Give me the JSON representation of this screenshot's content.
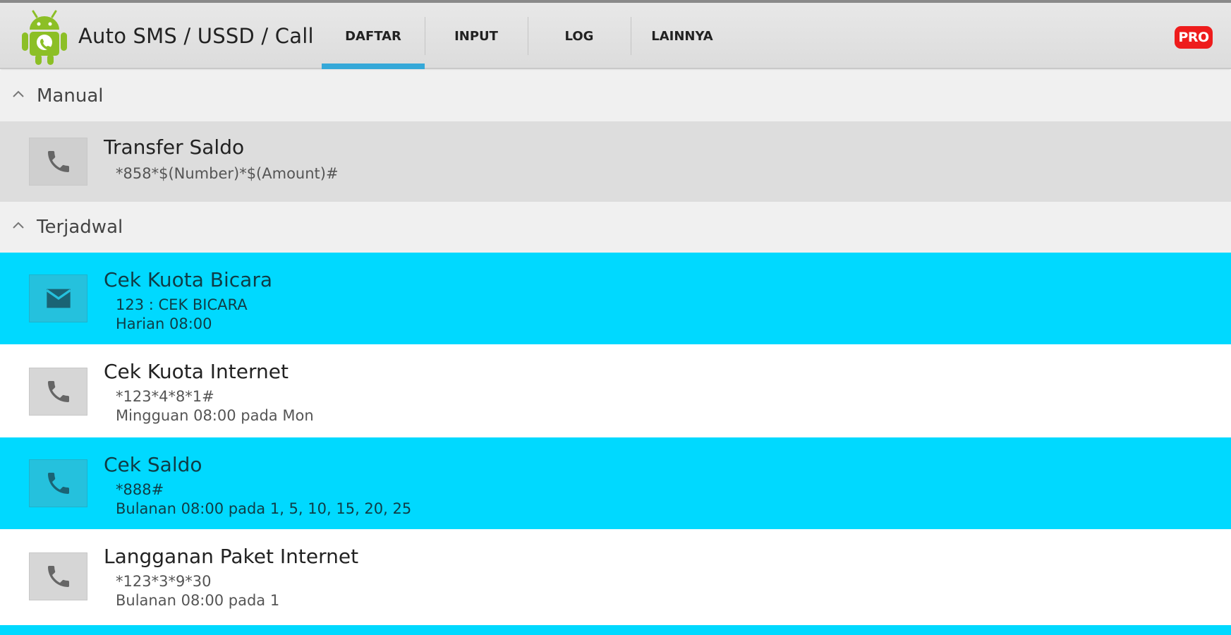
{
  "app": {
    "title": "Auto SMS / USSD / Call",
    "pro_label": "PRO"
  },
  "tabs": [
    {
      "label": "DAFTAR",
      "active": true
    },
    {
      "label": "INPUT",
      "active": false
    },
    {
      "label": "LOG",
      "active": false
    },
    {
      "label": "LAINNYA",
      "active": false
    }
  ],
  "sections": {
    "manual": {
      "label": "Manual",
      "items": [
        {
          "title": "Transfer Saldo",
          "code": "*858*$(Number)*$(Amount)#",
          "icon": "phone-icon"
        }
      ]
    },
    "scheduled": {
      "label": "Terjadwal",
      "items": [
        {
          "title": "Cek Kuota Bicara",
          "code": "123 : CEK BICARA",
          "schedule": "Harian 08:00",
          "icon": "envelope-icon",
          "highlighted": true
        },
        {
          "title": "Cek Kuota Internet",
          "code": "*123*4*8*1#",
          "schedule": "Mingguan 08:00 pada Mon",
          "icon": "phone-icon",
          "highlighted": false
        },
        {
          "title": "Cek Saldo",
          "code": "*888#",
          "schedule": "Bulanan 08:00 pada 1, 5, 10, 15, 20, 25",
          "icon": "phone-icon",
          "highlighted": true
        },
        {
          "title": "Langganan Paket Internet",
          "code": "*123*3*9*30",
          "schedule": "Bulanan 08:00 pada 1",
          "icon": "phone-icon",
          "highlighted": false
        }
      ]
    }
  },
  "colors": {
    "accent": "#35a8d8",
    "highlight": "#00d9ff",
    "pro": "#ee1c1c"
  }
}
